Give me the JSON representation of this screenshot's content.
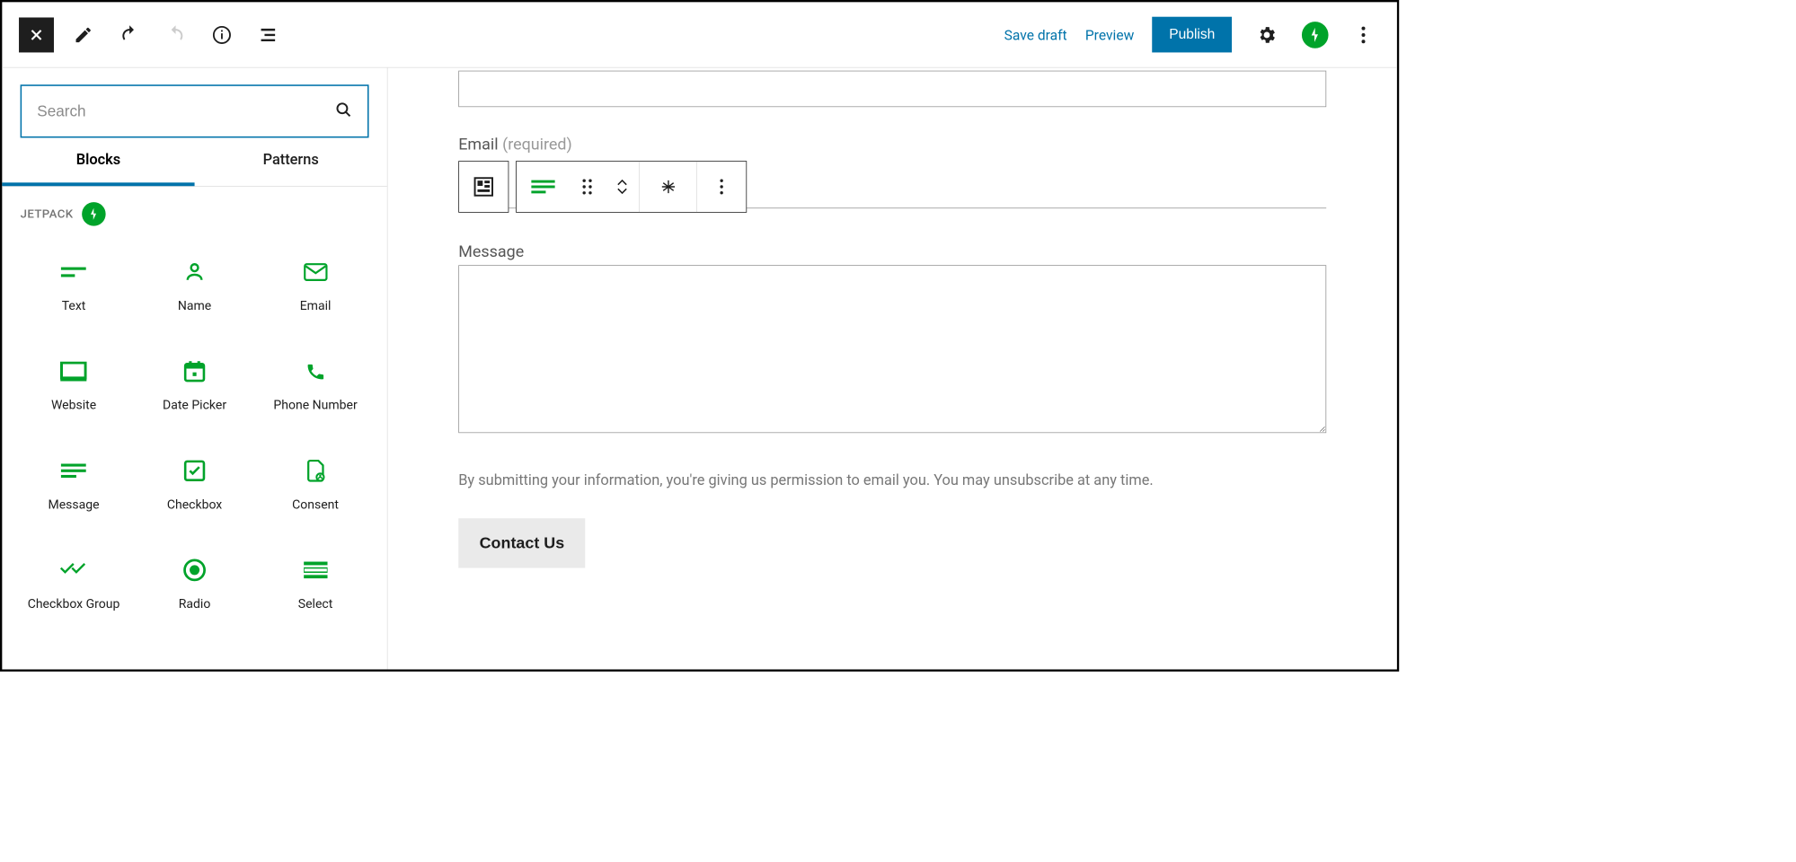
{
  "topbar": {
    "save_draft": "Save draft",
    "preview": "Preview",
    "publish": "Publish"
  },
  "sidebar": {
    "search_placeholder": "Search",
    "tabs": {
      "blocks": "Blocks",
      "patterns": "Patterns"
    },
    "section": "JETPACK",
    "blocks": [
      {
        "label": "Text"
      },
      {
        "label": "Name"
      },
      {
        "label": "Email"
      },
      {
        "label": "Website"
      },
      {
        "label": "Date Picker"
      },
      {
        "label": "Phone Number"
      },
      {
        "label": "Message"
      },
      {
        "label": "Checkbox"
      },
      {
        "label": "Consent"
      },
      {
        "label": "Checkbox Group"
      },
      {
        "label": "Radio"
      },
      {
        "label": "Select"
      }
    ]
  },
  "canvas": {
    "email_label": "Email",
    "email_required": "(required)",
    "message_label": "Message",
    "consent_text": "By submitting your information, you're giving us permission to email you. You may unsubscribe at any time.",
    "button_label": "Contact Us"
  }
}
